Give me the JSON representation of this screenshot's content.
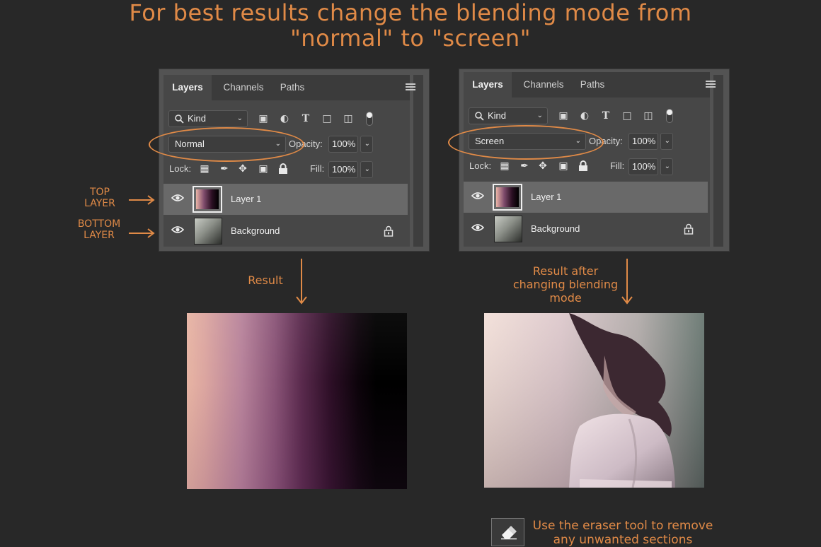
{
  "heading": {
    "line1": "For best results change the blending mode from",
    "line2": "\"normal\" to \"screen\""
  },
  "annotations": {
    "top_layer": [
      "TOP",
      "LAYER"
    ],
    "bottom_layer": [
      "BOTTOM",
      "LAYER"
    ],
    "result": "Result",
    "result_after": [
      "Result after",
      "changing blending",
      "mode"
    ],
    "eraser_tip": [
      "Use the eraser tool to remove",
      "any unwanted sections"
    ]
  },
  "panels": [
    {
      "tabs": [
        "Layers",
        "Channels",
        "Paths"
      ],
      "active_tab": "Layers",
      "filter_kind": "Kind",
      "blend_mode": "Normal",
      "opacity_label": "Opacity:",
      "opacity_value": "100%",
      "lock_label": "Lock:",
      "fill_label": "Fill:",
      "fill_value": "100%",
      "layers": [
        {
          "name": "Layer 1",
          "selected": true,
          "locked": false
        },
        {
          "name": "Background",
          "selected": false,
          "locked": true
        }
      ]
    },
    {
      "tabs": [
        "Layers",
        "Channels",
        "Paths"
      ],
      "active_tab": "Layers",
      "filter_kind": "Kind",
      "blend_mode": "Screen",
      "opacity_label": "Opacity:",
      "opacity_value": "100%",
      "lock_label": "Lock:",
      "fill_label": "Fill:",
      "fill_value": "100%",
      "layers": [
        {
          "name": "Layer 1",
          "selected": true,
          "locked": false
        },
        {
          "name": "Background",
          "selected": false,
          "locked": true
        }
      ]
    }
  ],
  "colors": {
    "accent": "#e08a47",
    "background": "#282828",
    "panel": "#474747",
    "selected_row": "#696969"
  },
  "icons": [
    "eye-icon",
    "lock-icon",
    "search-icon",
    "menu-icon",
    "eraser-icon",
    "chevron-down-icon"
  ]
}
